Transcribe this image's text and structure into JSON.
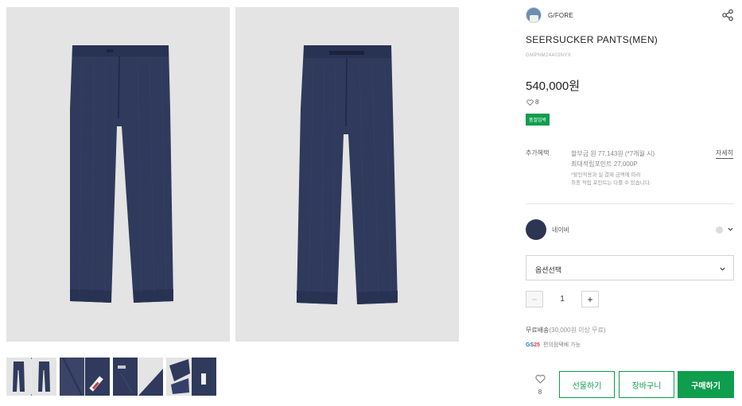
{
  "brand": {
    "name": "G/FORE",
    "logo_icon": "brand-logo-icon"
  },
  "product": {
    "title": "SEERSUCKER PANTS(MEN)",
    "code": "GMPNM24403NYX",
    "price": "540,000원",
    "likes": "8",
    "tag": "품절임박"
  },
  "benefits": {
    "label": "추가혜택",
    "line1": "할부금 원 77,143원 (*7개월 시)",
    "line2": "최대적립포인트 27,000P",
    "note1": "*할인적용과 실 결제 금액에 따라",
    "note2": "최종 적립 포인트는 다를 수 있습니다.",
    "detail_link": "자세히"
  },
  "color": {
    "name": "네이비",
    "swatch": "#2c3552"
  },
  "option": {
    "label": "옵션선택"
  },
  "quantity": {
    "minus": "−",
    "value": "1",
    "plus": "+"
  },
  "shipping": {
    "prefix": "무료배송",
    "detail": "(30,000원 이상 무료)"
  },
  "pickup": {
    "logo_a": "GS",
    "logo_b": "25",
    "text": "편의점택배 가능"
  },
  "actions": {
    "wish_count": "8",
    "gift": "선물하기",
    "cart": "장바구니",
    "buy": "구매하기"
  },
  "colors": {
    "accent": "#0f9d4e",
    "pants": "#2f3a5c",
    "photo_bg": "#e4e4e4"
  }
}
